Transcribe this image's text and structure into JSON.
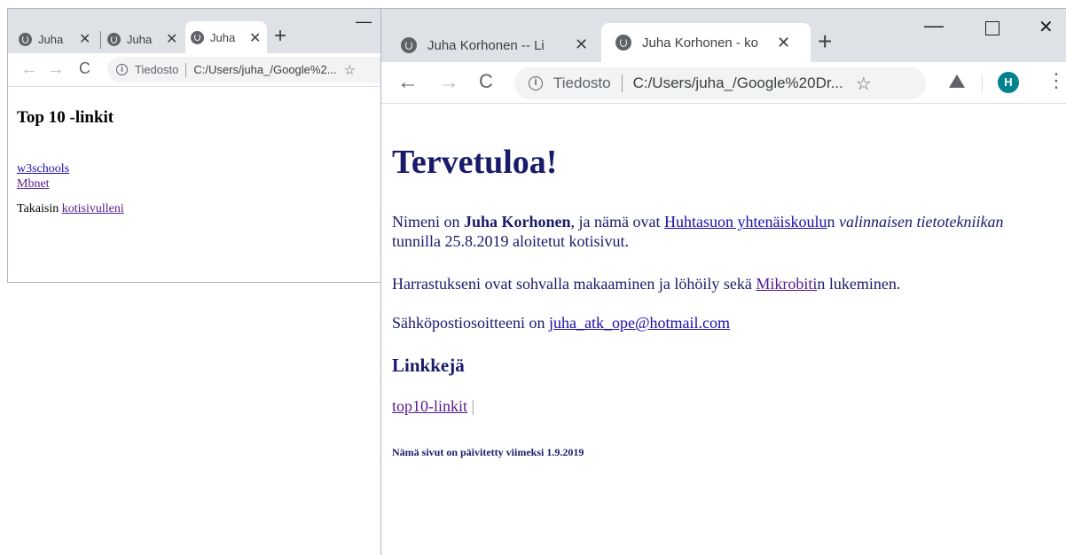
{
  "window1": {
    "tabs": [
      {
        "title": "Juha"
      },
      {
        "title": "Juha"
      },
      {
        "title": "Juha"
      }
    ],
    "omnibox": {
      "info_label": "Tiedosto",
      "url": "C:/Users/juha_/Google%2..."
    },
    "page": {
      "heading": "Top 10 -linkit",
      "links": [
        "w3schools",
        "Mbnet"
      ],
      "back_text": "Takaisin",
      "back_link": "kotisivulleni"
    }
  },
  "window2": {
    "tabs": [
      {
        "title": "Juha Korhonen -- Li"
      },
      {
        "title": "Juha Korhonen - ko"
      }
    ],
    "omnibox": {
      "info_label": "Tiedosto",
      "url": "C:/Users/juha_/Google%20Dr..."
    },
    "profile_initial": "H",
    "page": {
      "heading": "Tervetuloa!",
      "intro": {
        "p1": "Nimeni on ",
        "name": "Juha Korhonen",
        "p2": ", ja nämä ovat ",
        "school_link": "Huhtasuon yhtenäiskoulu",
        "p3": "n ",
        "course_italic": "valinnaisen tietotekniikan",
        "p4": " tunnilla 25.8.2019 aloitetut kotisivut."
      },
      "hobbies": {
        "p1": "Harrastukseni ovat sohvalla makaaminen ja löhöily sekä ",
        "link": "Mikrobiti",
        "p2": "n lukeminen."
      },
      "email": {
        "p1": "Sähköpostiosoitteeni on ",
        "link": "juha_atk_ope@hotmail.com"
      },
      "links_heading": "Linkkejä",
      "links": [
        "top10-linkit"
      ],
      "links_separator": "|",
      "footer": "Nämä sivut on päivitetty viimeksi 1.9.2019"
    }
  },
  "colors": {
    "page_text": "#1a1a6b",
    "link": "#1a0dab",
    "visited_link": "#551a8b",
    "profile_avatar": "#00838f",
    "tabstrip": "#dee1e6"
  }
}
